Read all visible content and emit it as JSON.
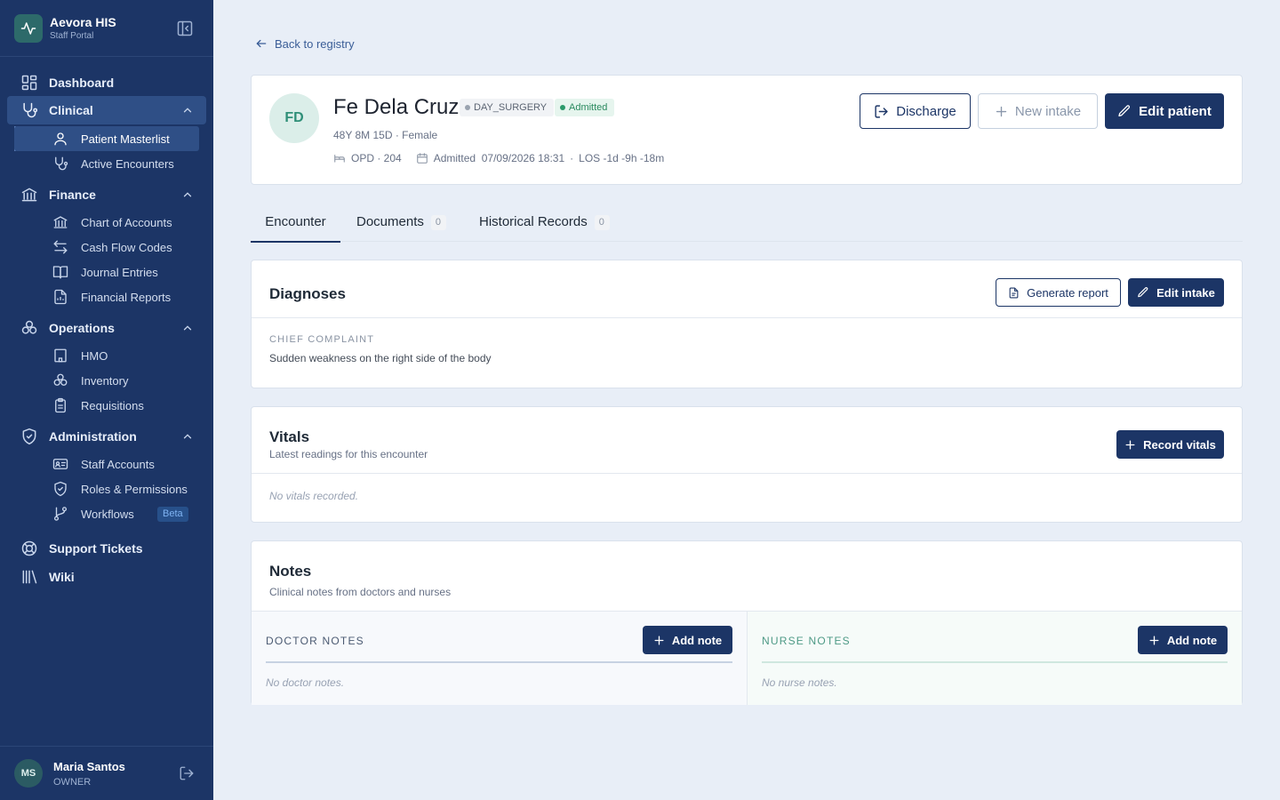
{
  "app": {
    "name": "Aevora HIS",
    "subtitle": "Staff Portal"
  },
  "sidebar": {
    "dashboard": "Dashboard",
    "clinical": {
      "label": "Clinical",
      "items": [
        "Patient Masterlist",
        "Active Encounters"
      ]
    },
    "finance": {
      "label": "Finance",
      "items": [
        "Chart of Accounts",
        "Cash Flow Codes",
        "Journal Entries",
        "Financial Reports"
      ]
    },
    "operations": {
      "label": "Operations",
      "items": [
        "HMO",
        "Inventory",
        "Requisitions"
      ]
    },
    "administration": {
      "label": "Administration",
      "items": [
        "Staff Accounts",
        "Roles & Permissions",
        "Workflows"
      ],
      "workflows_badge": "Beta"
    },
    "support": "Support Tickets",
    "wiki": "Wiki"
  },
  "user": {
    "initials": "MS",
    "name": "Maria Santos",
    "role": "OWNER"
  },
  "back_link": "Back to registry",
  "patient": {
    "initials": "FD",
    "name": "Fe Dela Cruz",
    "type_chip": "DAY_SURGERY",
    "status_chip": "Admitted",
    "meta": "48Y 8M 15D · Female",
    "location": "OPD · 204",
    "admitted": "Admitted  07/09/2026 18:31",
    "los": "LOS -1d -9h -18m"
  },
  "header_actions": {
    "discharge": "Discharge",
    "new_intake": "New intake",
    "edit_patient": "Edit patient"
  },
  "tabs": [
    {
      "label": "Encounter",
      "count": ""
    },
    {
      "label": "Documents",
      "count": "0"
    },
    {
      "label": "Historical Records",
      "count": "0"
    }
  ],
  "diagnoses": {
    "title": "Diagnoses",
    "generate_report": "Generate report",
    "edit_intake": "Edit intake",
    "chief_complaint_label": "CHIEF COMPLAINT",
    "chief_complaint": "Sudden weakness on the right side of the body"
  },
  "vitals": {
    "title": "Vitals",
    "subtitle": "Latest readings for this encounter",
    "record_button": "Record vitals",
    "empty": "No vitals recorded."
  },
  "notes": {
    "title": "Notes",
    "subtitle": "Clinical notes from doctors and nurses",
    "doctor": {
      "label": "DOCTOR NOTES",
      "button": "Add note",
      "empty": "No doctor notes."
    },
    "nurse": {
      "label": "NURSE NOTES",
      "button": "Add note",
      "empty": "No nurse notes."
    }
  },
  "colors": {
    "sidebar": "#1c3566",
    "primary": "#1c3566",
    "background": "#e8eef7",
    "success": "#2b8a5f",
    "nurse_accent": "#4e9a86"
  }
}
